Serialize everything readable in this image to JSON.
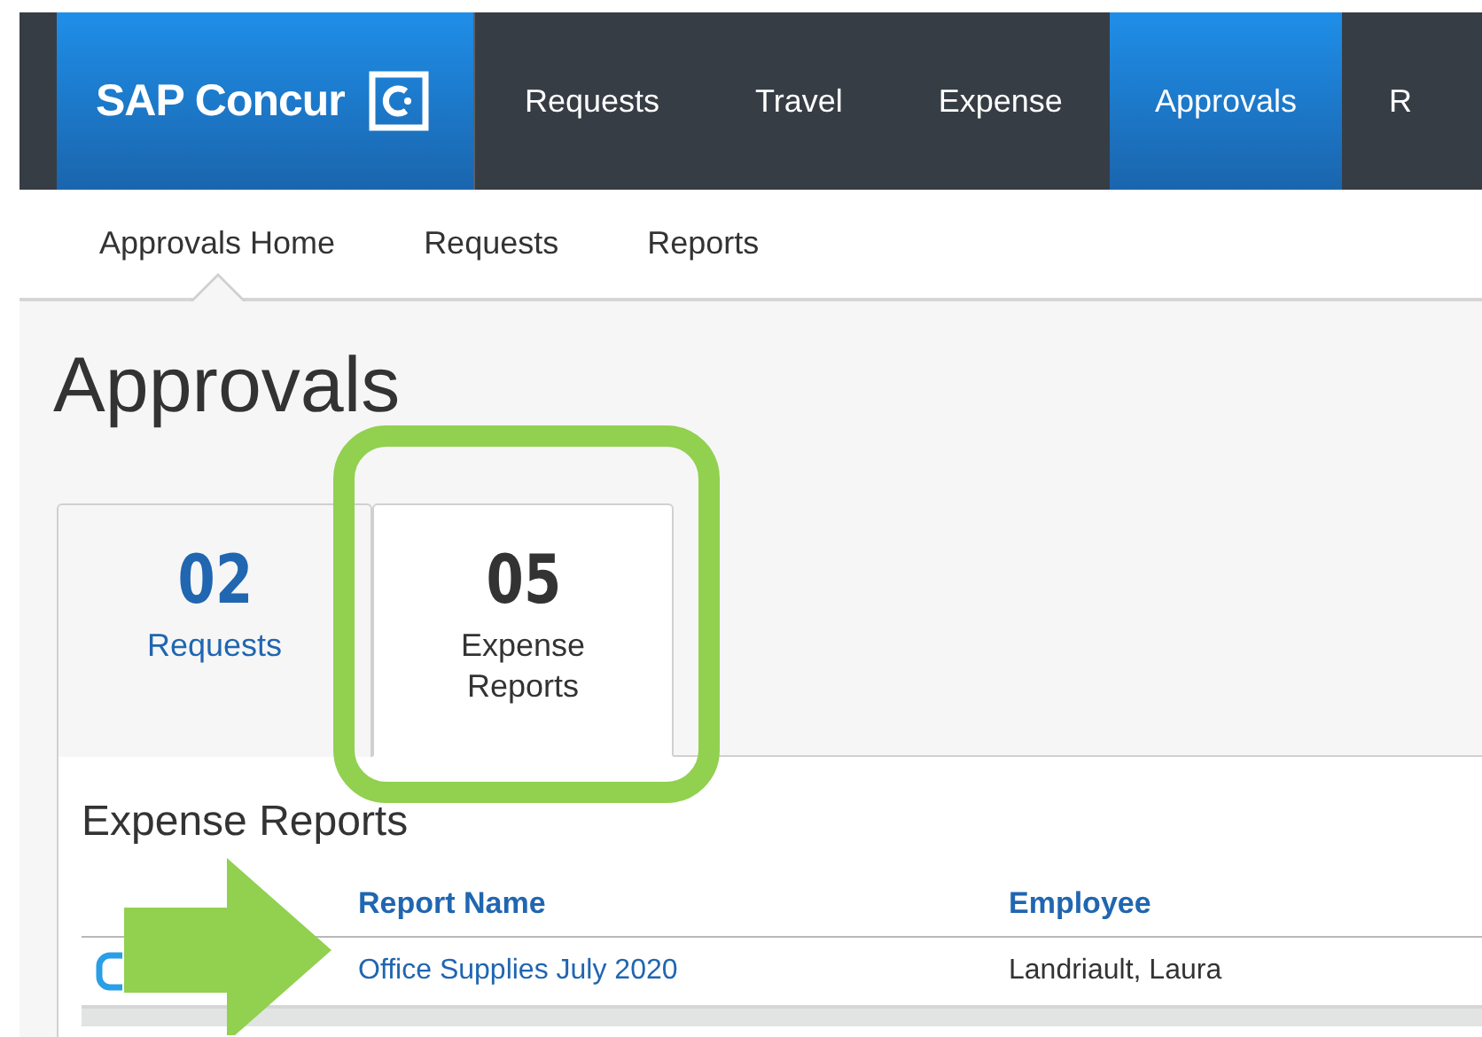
{
  "header": {
    "logo": "SAP Concur",
    "nav": [
      {
        "label": "Requests",
        "selected": false
      },
      {
        "label": "Travel",
        "selected": false
      },
      {
        "label": "Expense",
        "selected": false
      },
      {
        "label": "Approvals",
        "selected": true
      },
      {
        "label": "R",
        "selected": false
      }
    ]
  },
  "subnav": [
    {
      "label": "Approvals Home",
      "selected": true
    },
    {
      "label": "Requests",
      "selected": false
    },
    {
      "label": "Reports",
      "selected": false
    }
  ],
  "page_title": "Approvals",
  "tabs": [
    {
      "count": "02",
      "label": "Requests",
      "selected": false
    },
    {
      "count": "05",
      "label": "Expense Reports",
      "selected": true
    }
  ],
  "section_title": "Expense Reports",
  "table": {
    "columns": [
      "Report Name",
      "Employee"
    ],
    "rows": [
      {
        "report_name": "Office Supplies July 2020",
        "employee": "Landriault, Laura"
      }
    ]
  }
}
